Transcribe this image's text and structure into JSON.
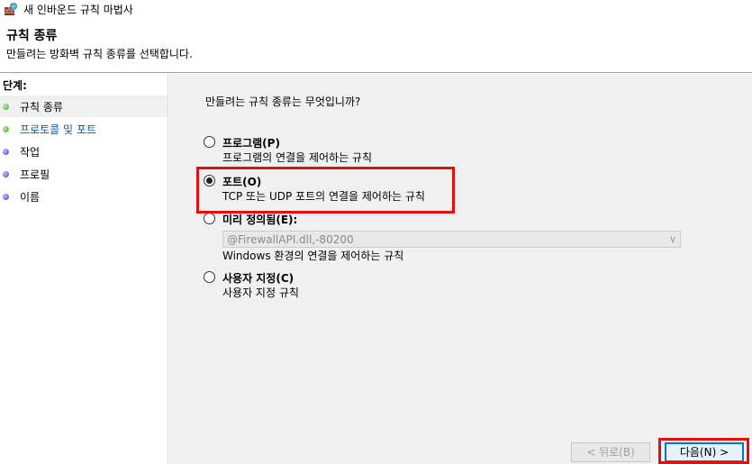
{
  "window": {
    "title": "새 인바운드 규칙 마법사",
    "icon": "firewall-wizard-icon"
  },
  "header": {
    "title": "규칙 종류",
    "description": "만들려는 방화벽 규칙 종류를 선택합니다."
  },
  "sidebar": {
    "steps_label": "단계:",
    "items": [
      {
        "label": "규칙 종류",
        "state": "current",
        "dot": "green"
      },
      {
        "label": "프로토콜 및 포트",
        "state": "link",
        "dot": "green"
      },
      {
        "label": "작업",
        "state": "pending",
        "dot": "purple"
      },
      {
        "label": "프로필",
        "state": "pending",
        "dot": "purple"
      },
      {
        "label": "이름",
        "state": "pending",
        "dot": "purple"
      }
    ]
  },
  "main": {
    "question": "만들려는 규칙 종류는 무엇입니까?",
    "options": [
      {
        "label": "프로그램(P)",
        "description": "프로그램의 연결을 제어하는 규칙",
        "checked": false
      },
      {
        "label": "포트(O)",
        "description": "TCP 또는 UDP 포트의 연결을 제어하는 규칙",
        "checked": true
      },
      {
        "label": "미리 정의됨(E):",
        "description": "Windows 환경의 연결을 제어하는 규칙",
        "checked": false,
        "select_value": "@FirewallAPI.dll,-80200"
      },
      {
        "label": "사용자 지정(C)",
        "description": "사용자 지정 규칙",
        "checked": false
      }
    ]
  },
  "footer": {
    "back_label": "< 뒤로(B)",
    "next_label": "다음(N) >"
  },
  "colors": {
    "highlight": "#e01010",
    "link": "#0c5aa8"
  }
}
